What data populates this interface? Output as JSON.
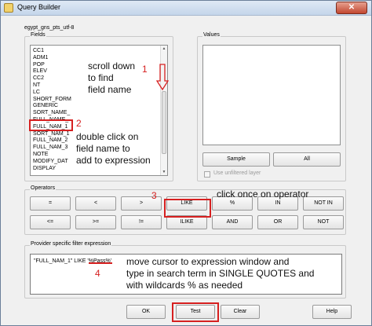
{
  "window": {
    "title": "Query Builder",
    "close_symbol": "✕"
  },
  "layer_name": "egypt_gns_pts_utf-8",
  "fields": {
    "label": "Fields",
    "items": [
      "CC1",
      "ADM1",
      "POP",
      "ELEV",
      "CC2",
      "NT",
      "LC",
      "SHORT_FORM",
      "GENERIC",
      "SORT_NAME_",
      "FULL_NAME_",
      "FULL_NAM_1",
      "SORT_NAM_1",
      "FULL_NAM_2",
      "FULL_NAM_3",
      "NOTE",
      "MODIFY_DAT",
      "DISPLAY"
    ],
    "highlighted": "FULL_NAM_1"
  },
  "values": {
    "label": "Values",
    "sample_label": "Sample",
    "all_label": "All",
    "unfiltered_label": "Use unfiltered layer"
  },
  "operators": {
    "label": "Operators",
    "row1": [
      "=",
      "<",
      ">",
      "LIKE",
      "%",
      "IN",
      "NOT IN"
    ],
    "row2": [
      "<=",
      ">=",
      "!=",
      "ILIKE",
      "AND",
      "OR",
      "NOT"
    ]
  },
  "filter": {
    "label": "Provider specific filter expression",
    "expression": "\"FULL_NAM_1\" LIKE '%Pass%'"
  },
  "buttons": {
    "ok": "OK",
    "test": "Test",
    "clear": "Clear",
    "help": "Help"
  },
  "annotations": {
    "n1": "1",
    "n2": "2",
    "n3": "3",
    "n4": "4",
    "note1": [
      "scroll down",
      "to find",
      "field name"
    ],
    "note2": [
      "double click on",
      "field name to",
      "add to expression"
    ],
    "note3": "click once on operator",
    "note4": [
      "move cursor to expression window and",
      "type in search term in SINGLE QUOTES and",
      "with wildcards % as needed"
    ]
  },
  "colors": {
    "annotation": "#d62020",
    "titlebar": "#c4d5ea",
    "close": "#c24730"
  }
}
